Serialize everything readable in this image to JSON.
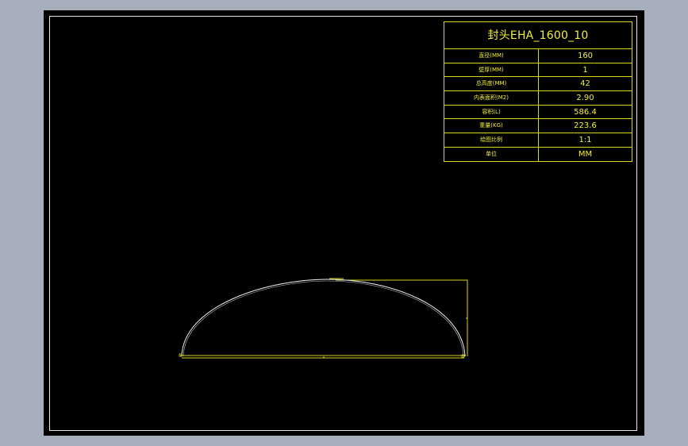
{
  "title_block": {
    "title": "封头EHA_1600_10",
    "rows": [
      {
        "label": "直径(MM)",
        "value": "160"
      },
      {
        "label": "壁厚(MM)",
        "value": "1"
      },
      {
        "label": "总高度(MM)",
        "value": "42"
      },
      {
        "label": "内表面积(M2)",
        "value": "2.90"
      },
      {
        "label": "容积(L)",
        "value": "586.4"
      },
      {
        "label": "重量(KG)",
        "value": "223.6"
      },
      {
        "label": "绘图比例",
        "value": "1:1"
      },
      {
        "label": "单位",
        "value": "MM"
      }
    ]
  },
  "colors": {
    "background": "#000000",
    "frame": "#e6e6e6",
    "annotation": "#f1ee3c",
    "curve": "#f0f0f0",
    "viewport": "#a6aebb"
  }
}
